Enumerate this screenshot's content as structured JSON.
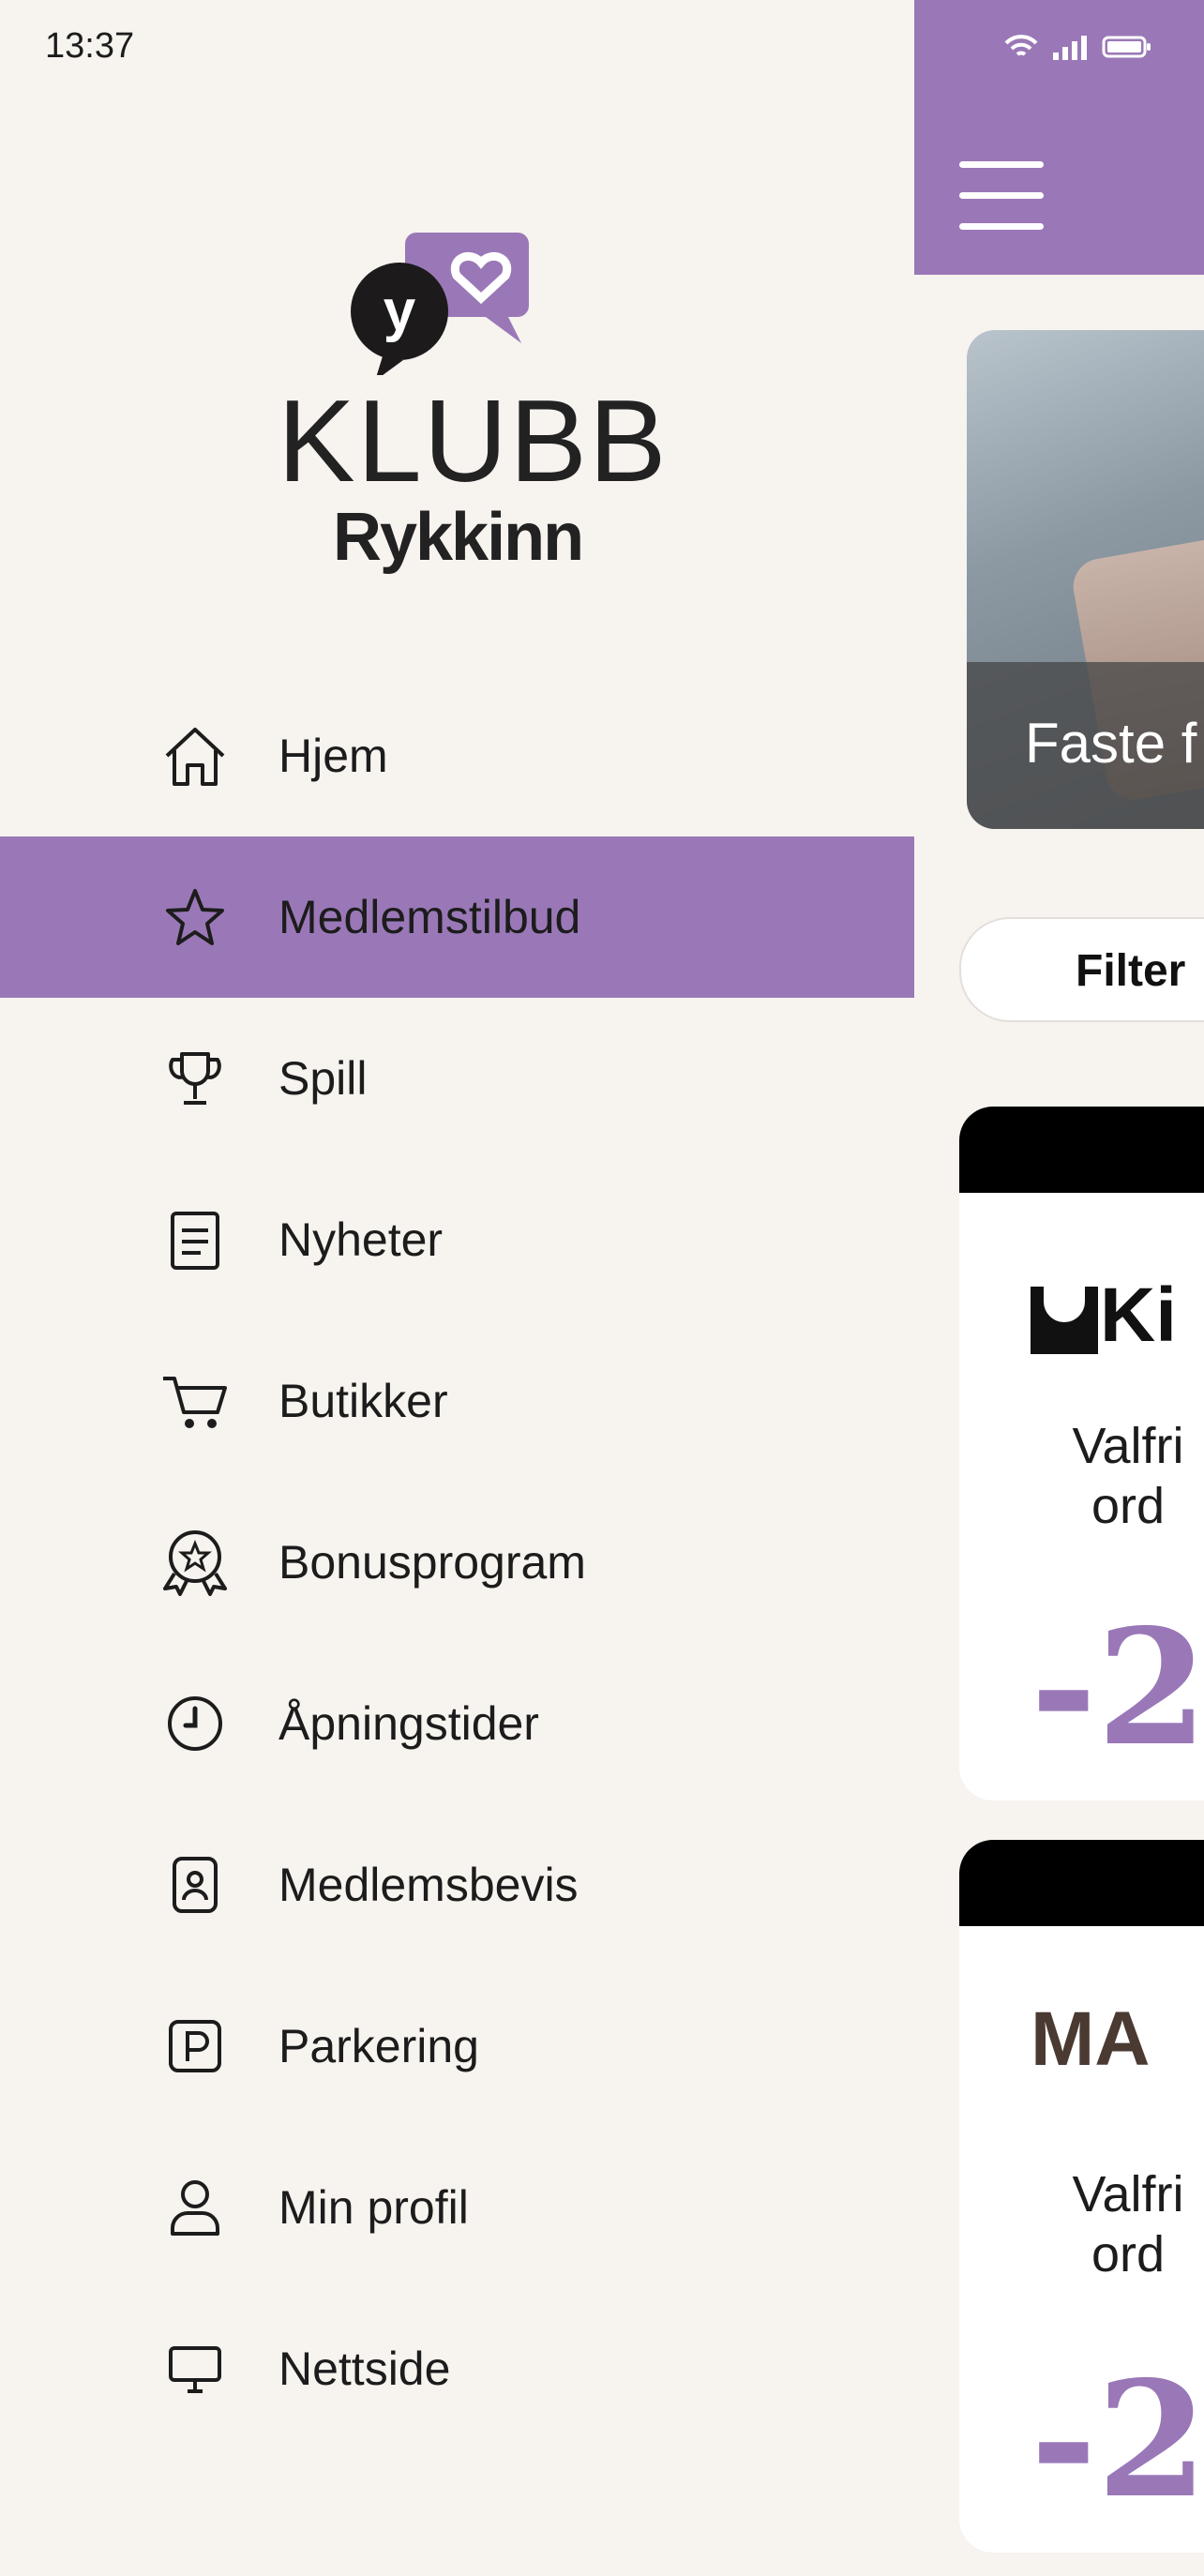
{
  "status_bar": {
    "time": "13:37"
  },
  "logo": {
    "word": "KLUBB",
    "brand": "Rykkinn",
    "badge_letter": "y",
    "accent": "#9a78b7"
  },
  "menu": {
    "items": [
      {
        "label": "Hjem",
        "icon": "home-icon",
        "active": false
      },
      {
        "label": "Medlemstilbud",
        "icon": "star-icon",
        "active": true
      },
      {
        "label": "Spill",
        "icon": "trophy-icon",
        "active": false
      },
      {
        "label": "Nyheter",
        "icon": "news-icon",
        "active": false
      },
      {
        "label": "Butikker",
        "icon": "cart-icon",
        "active": false
      },
      {
        "label": "Bonusprogram",
        "icon": "badge-icon",
        "active": false
      },
      {
        "label": "Åpningstider",
        "icon": "clock-icon",
        "active": false
      },
      {
        "label": "Medlemsbevis",
        "icon": "member-card-icon",
        "active": false
      },
      {
        "label": "Parkering",
        "icon": "parking-icon",
        "active": false
      },
      {
        "label": "Min profil",
        "icon": "user-icon",
        "active": false
      },
      {
        "label": "Nettside",
        "icon": "monitor-icon",
        "active": false
      }
    ]
  },
  "main": {
    "hero_title": "Faste f",
    "filter_label": "Filter",
    "cards": [
      {
        "brand": "Ki",
        "desc_1": "Valfri",
        "desc_2": "ord",
        "discount": "-2"
      },
      {
        "brand": "MA",
        "desc_1": "Valfri",
        "desc_2": "ord",
        "discount": "-2"
      }
    ]
  }
}
